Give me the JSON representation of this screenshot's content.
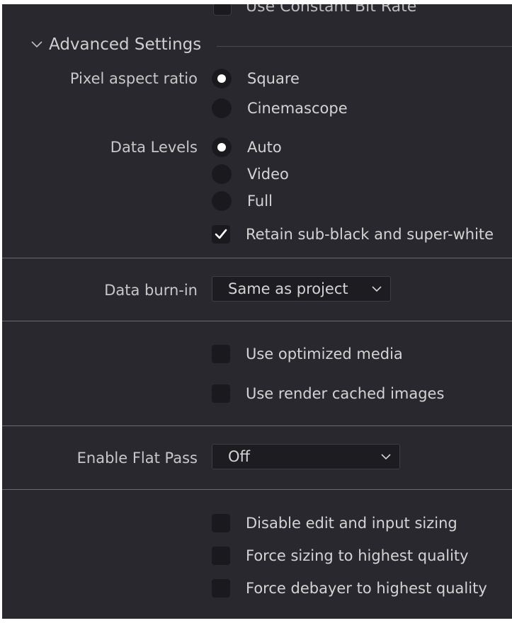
{
  "top_cutoff": {
    "label": "Use Constant Bit Rate"
  },
  "advanced": {
    "title": "Advanced Settings",
    "pixel_aspect": {
      "label": "Pixel aspect ratio",
      "options": [
        {
          "label": "Square",
          "selected": true
        },
        {
          "label": "Cinemascope",
          "selected": false
        }
      ]
    },
    "data_levels": {
      "label": "Data Levels",
      "options": [
        {
          "label": "Auto",
          "selected": true
        },
        {
          "label": "Video",
          "selected": false
        },
        {
          "label": "Full",
          "selected": false
        }
      ],
      "retain": {
        "label": "Retain sub-black and super-white",
        "checked": true
      }
    }
  },
  "data_burnin": {
    "label": "Data burn-in",
    "value": "Same as project"
  },
  "media": {
    "optimized": {
      "label": "Use optimized media",
      "checked": false
    },
    "render_cached": {
      "label": "Use render cached images",
      "checked": false
    }
  },
  "flat_pass": {
    "label": "Enable Flat Pass",
    "value": "Off"
  },
  "sizing": {
    "disable_edit": {
      "label": "Disable edit and input sizing",
      "checked": false
    },
    "force_sizing": {
      "label": "Force sizing to highest quality",
      "checked": false
    },
    "force_debayer": {
      "label": "Force debayer to highest quality",
      "checked": false
    }
  },
  "colors": {
    "panel_bg": "#28282e",
    "control_bg": "#1a1a1e",
    "text": "#d4d4d4",
    "divider": "#6a6a70"
  }
}
